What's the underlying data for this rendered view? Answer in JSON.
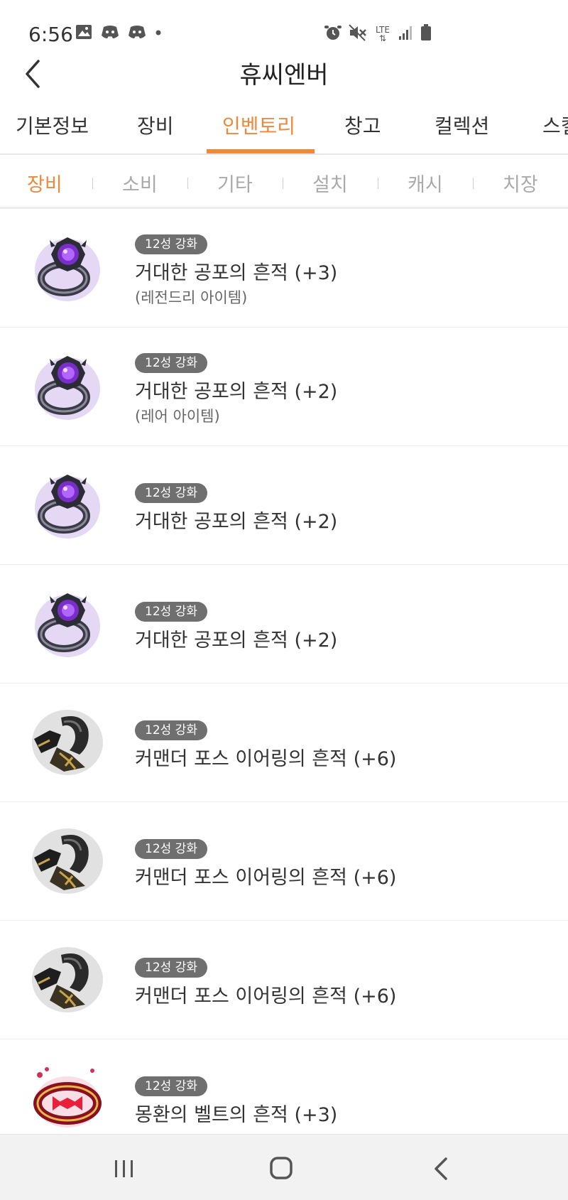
{
  "status": {
    "time": "6:56",
    "left_icons": [
      "image-icon",
      "discord-icon",
      "discord-icon",
      "dot-icon"
    ],
    "right_icons": [
      "alarm-icon",
      "mute-icon",
      "lte-icon",
      "signal-icon",
      "battery-icon"
    ],
    "lte_label": "LTE"
  },
  "header": {
    "title": "휴씨엔버"
  },
  "main_tabs": [
    {
      "label": "기본정보"
    },
    {
      "label": "장비"
    },
    {
      "label": "인벤토리",
      "active": true
    },
    {
      "label": "창고"
    },
    {
      "label": "컬렉션"
    },
    {
      "label": "스킬"
    }
  ],
  "sub_tabs": [
    {
      "label": "장비",
      "active": true
    },
    {
      "label": "소비"
    },
    {
      "label": "기타"
    },
    {
      "label": "설치"
    },
    {
      "label": "캐시"
    },
    {
      "label": "치장"
    }
  ],
  "items": [
    {
      "badge": "12성 강화",
      "name": "거대한 공포의 흔적 (+3)",
      "grade": "(레전드리 아이템)",
      "icon": "ring-icon"
    },
    {
      "badge": "12성 강화",
      "name": "거대한 공포의 흔적 (+2)",
      "grade": "(레어 아이템)",
      "icon": "ring-icon"
    },
    {
      "badge": "12성 강화",
      "name": "거대한 공포의 흔적 (+2)",
      "grade": "",
      "icon": "ring-icon"
    },
    {
      "badge": "12성 강화",
      "name": "거대한 공포의 흔적 (+2)",
      "grade": "",
      "icon": "ring-icon"
    },
    {
      "badge": "12성 강화",
      "name": "커맨더 포스 이어링의 흔적 (+6)",
      "grade": "",
      "icon": "earring-icon"
    },
    {
      "badge": "12성 강화",
      "name": "커맨더 포스 이어링의 흔적 (+6)",
      "grade": "",
      "icon": "earring-icon"
    },
    {
      "badge": "12성 강화",
      "name": "커맨더 포스 이어링의 흔적 (+6)",
      "grade": "",
      "icon": "earring-icon"
    },
    {
      "badge": "12성 강화",
      "name": "몽환의 벨트의 흔적 (+3)",
      "grade": "",
      "icon": "belt-icon"
    }
  ],
  "colors": {
    "accent": "#f0883a",
    "badge_bg": "#6f6f6f"
  },
  "nav": [
    "recent-apps-icon",
    "home-icon",
    "back-icon"
  ]
}
